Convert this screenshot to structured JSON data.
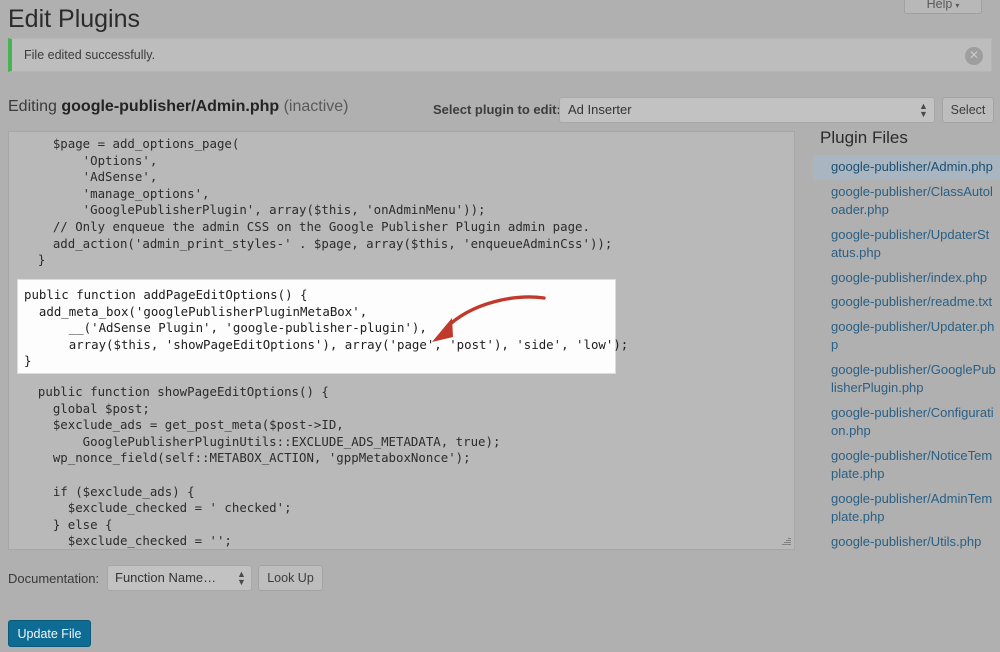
{
  "help_tab": {
    "label": "Help",
    "caret": "▾"
  },
  "page_title": "Edit Plugins",
  "notice": {
    "message": "File edited successfully.",
    "dismiss_icon": "✕",
    "accent_color": "#46b450"
  },
  "editing": {
    "prefix": "Editing",
    "filename": "google-publisher/Admin.php",
    "state": "(inactive)"
  },
  "plugin_selector": {
    "label": "Select plugin to edit:",
    "selected": "Ad Inserter",
    "arrows_icon": "▴▾",
    "select_button": "Select"
  },
  "editor": {
    "code_before": "    $page = add_options_page(\n        'Options',\n        'AdSense',\n        'manage_options',\n        'GooglePublisherPlugin', array($this, 'onAdminMenu'));\n    // Only enqueue the admin CSS on the Google Publisher Plugin admin page.\n    add_action('admin_print_styles-' . $page, array($this, 'enqueueAdminCss'));\n  }",
    "code_after": "  public function showPageEditOptions() {\n    global $post;\n    $exclude_ads = get_post_meta($post->ID,\n        GooglePublisherPluginUtils::EXCLUDE_ADS_METADATA, true);\n    wp_nonce_field(self::METABOX_ACTION, 'gppMetaboxNonce');\n\n    if ($exclude_ads) {\n      $exclude_checked = ' checked';\n    } else {\n      $exclude_checked = '';"
  },
  "highlight": {
    "code": "public function addPageEditOptions() {\n  add_meta_box('googlePublisherPluginMetaBox',\n      __('AdSense Plugin', 'google-publisher-plugin'),\n      array($this, 'showPageEditOptions'), array('page', 'post'), 'side', 'low');\n}",
    "background": "#fdfdfd"
  },
  "annotation": {
    "type": "curved-arrow",
    "color": "#c0392b",
    "points_to": "end of __('AdSense Plugin', 'google-publisher-plugin'), line"
  },
  "documentation": {
    "label": "Documentation:",
    "selected": "Function Name…",
    "arrows_icon": "▴▾",
    "lookup_button": "Look Up"
  },
  "update_button": {
    "label": "Update File",
    "color": "#0d6b94"
  },
  "plugin_files": {
    "title": "Plugin Files",
    "items": [
      {
        "name": "google-publisher/Admin.php",
        "active": true
      },
      {
        "name": "google-publisher/ClassAutoloader.php",
        "active": false
      },
      {
        "name": "google-publisher/UpdaterStatus.php",
        "active": false
      },
      {
        "name": "google-publisher/index.php",
        "active": false
      },
      {
        "name": "google-publisher/readme.txt",
        "active": false
      },
      {
        "name": "google-publisher/Updater.php",
        "active": false
      },
      {
        "name": "google-publisher/GooglePublisherPlugin.php",
        "active": false
      },
      {
        "name": "google-publisher/Configuration.php",
        "active": false
      },
      {
        "name": "google-publisher/NoticeTemplate.php",
        "active": false
      },
      {
        "name": "google-publisher/AdminTemplate.php",
        "active": false
      },
      {
        "name": "google-publisher/Utils.php",
        "active": false
      }
    ]
  }
}
